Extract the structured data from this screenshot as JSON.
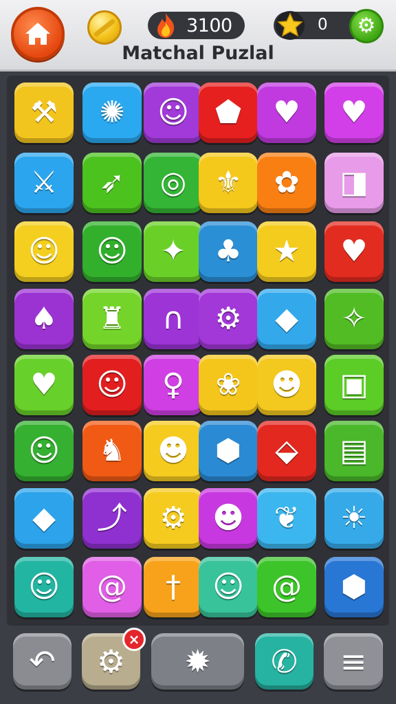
{
  "header": {
    "title": "Matchal Puzlal",
    "score": "3100",
    "stars": "0",
    "icons": {
      "home": "home-icon",
      "coin": "coin-icon",
      "score": "flame-icon",
      "stars": "star-icon",
      "settings": "gear-icon"
    }
  },
  "board": {
    "rows": 8,
    "cols": 6,
    "tiles": [
      [
        {
          "icon": "pickaxe",
          "color": "#f2c51e",
          "glyph": "⚒"
        },
        {
          "icon": "paint-splash",
          "color": "#2aa8f0",
          "glyph": "✺"
        },
        {
          "icon": "cat-face",
          "color": "#a13ad8",
          "glyph": "☺"
        },
        {
          "icon": "shield-gem",
          "color": "#e5201f",
          "glyph": "⬟"
        },
        {
          "icon": "heart",
          "color": "#c03ae0",
          "glyph": "♥"
        },
        {
          "icon": "heart",
          "color": "#d23fe8",
          "glyph": "♥"
        }
      ],
      [
        {
          "icon": "crossed-swords",
          "color": "#2ba6ee",
          "glyph": "⚔"
        },
        {
          "icon": "arrow",
          "color": "#4cc21f",
          "glyph": "➶"
        },
        {
          "icon": "ring",
          "color": "#34b535",
          "glyph": "◎"
        },
        {
          "icon": "crest",
          "color": "#f5c81c",
          "glyph": "⚜"
        },
        {
          "icon": "purple-flower",
          "color": "#f97f13",
          "glyph": "✿"
        },
        {
          "icon": "cube-box",
          "color": "#e79be8",
          "glyph": "◨"
        }
      ],
      [
        {
          "icon": "cat-face",
          "color": "#f4cf1f",
          "glyph": "☺"
        },
        {
          "icon": "cat-face",
          "color": "#32b02c",
          "glyph": "☺"
        },
        {
          "icon": "purple-blob",
          "color": "#6ad028",
          "glyph": "✦"
        },
        {
          "icon": "cactus",
          "color": "#2b8fd6",
          "glyph": "♣"
        },
        {
          "icon": "star-face",
          "color": "#f4cc1e",
          "glyph": "★"
        },
        {
          "icon": "heart",
          "color": "#e32c20",
          "glyph": "♥"
        }
      ],
      [
        {
          "icon": "spoon",
          "color": "#9b33d2",
          "glyph": "♠"
        },
        {
          "icon": "tower",
          "color": "#74d42a",
          "glyph": "♜"
        },
        {
          "icon": "horseshoe",
          "color": "#9c34d6",
          "glyph": "∩"
        },
        {
          "icon": "gear",
          "color": "#a238d8",
          "glyph": "⚙"
        },
        {
          "icon": "gem",
          "color": "#33a9ec",
          "glyph": "◆"
        },
        {
          "icon": "blue-gem",
          "color": "#52bc24",
          "glyph": "✧"
        }
      ],
      [
        {
          "icon": "heart-drop",
          "color": "#68d02a",
          "glyph": "♥"
        },
        {
          "icon": "cat-face",
          "color": "#e21e1f",
          "glyph": "☺"
        },
        {
          "icon": "lightbulb",
          "color": "#cf3fe3",
          "glyph": "♀"
        },
        {
          "icon": "flower",
          "color": "#f4c61c",
          "glyph": "❀"
        },
        {
          "icon": "bat-face",
          "color": "#f3c81f",
          "glyph": "☻"
        },
        {
          "icon": "box",
          "color": "#5ccc27",
          "glyph": "▣"
        }
      ],
      [
        {
          "icon": "cat-face",
          "color": "#35b030",
          "glyph": "☺"
        },
        {
          "icon": "bird",
          "color": "#f15a14",
          "glyph": "♞"
        },
        {
          "icon": "lion-face",
          "color": "#f5cb20",
          "glyph": "☻"
        },
        {
          "icon": "shield",
          "color": "#2b8ad4",
          "glyph": "⬢"
        },
        {
          "icon": "crystal",
          "color": "#e32820",
          "glyph": "⬙"
        },
        {
          "icon": "crate",
          "color": "#4ab82a",
          "glyph": "▤"
        }
      ],
      [
        {
          "icon": "red-gem",
          "color": "#2ca3ea",
          "glyph": "◆"
        },
        {
          "icon": "boomerang",
          "color": "#8f30d0",
          "glyph": "⤴"
        },
        {
          "icon": "pink-gear",
          "color": "#f5cb1f",
          "glyph": "⚙"
        },
        {
          "icon": "alien-face",
          "color": "#c838e0",
          "glyph": "☻"
        },
        {
          "icon": "leaf",
          "color": "#3cb6ee",
          "glyph": "❦"
        },
        {
          "icon": "sun",
          "color": "#36aae8",
          "glyph": "☀"
        }
      ],
      [
        {
          "icon": "cat-face",
          "color": "#22b5a2",
          "glyph": "☺"
        },
        {
          "icon": "swirl",
          "color": "#e05fe6",
          "glyph": "@"
        },
        {
          "icon": "dagger",
          "color": "#f7a21a",
          "glyph": "†"
        },
        {
          "icon": "goat-face",
          "color": "#38c39a",
          "glyph": "☺"
        },
        {
          "icon": "swirl",
          "color": "#3dc42a",
          "glyph": "@"
        },
        {
          "icon": "bolt",
          "color": "#2877d4",
          "glyph": "⬢"
        }
      ]
    ]
  },
  "bottom_bar": {
    "buttons": [
      {
        "name": "undo",
        "icon": "undo-icon",
        "glyph": "↶",
        "color": "#8a8c92"
      },
      {
        "name": "settings",
        "icon": "gear-icon",
        "glyph": "⚙",
        "color": "#b9ad8f",
        "badge": "×"
      },
      {
        "name": "burst",
        "icon": "burst-icon",
        "glyph": "✹",
        "color": "#7d8087"
      },
      {
        "name": "phone",
        "icon": "phone-icon",
        "glyph": "✆",
        "color": "#26b3a2"
      },
      {
        "name": "menu",
        "icon": "menu-icon",
        "glyph": "≡",
        "color": "#8f9197"
      }
    ]
  }
}
